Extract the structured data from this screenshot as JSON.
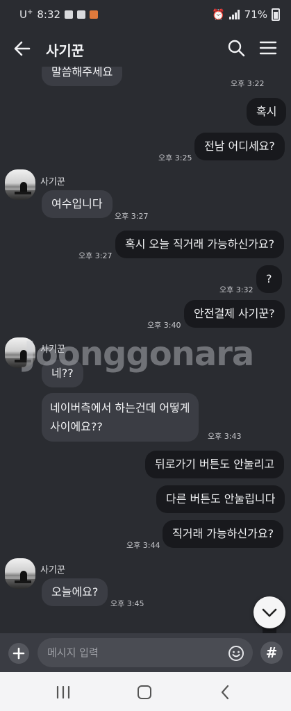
{
  "status_bar": {
    "carrier": "U",
    "carrier_sup": "+",
    "time": "8:32",
    "battery": "71%",
    "battery_level": 0.71
  },
  "header": {
    "title": "사기꾼"
  },
  "messages": [
    {
      "text": "말씀해주세요",
      "time": "오후 3:22"
    },
    {
      "text": "혹시"
    },
    {
      "text": "전남 어디세요?",
      "time": "오후 3:25"
    },
    {
      "sender": "사기꾼"
    },
    {
      "text": "여수입니다",
      "time": "오후 3:27"
    },
    {
      "text": "혹시 오늘 직거래 가능하신가요?",
      "time": "오후 3:27"
    },
    {
      "text": "?",
      "time": "오후 3:32"
    },
    {
      "text": "안전결제 사기꾼?",
      "time": "오후 3:40"
    },
    {
      "sender": "사기꾼"
    },
    {
      "text": "네??"
    },
    {
      "text_line1": "네이버측에서 하는건데 어떻게",
      "text_line2": "사이에요??",
      "time": "오후 3:43"
    },
    {
      "text": "뒤로가기 버튼도 안눌리고"
    },
    {
      "text": "다른 버튼도 안눌립니다"
    },
    {
      "text": "직거래 가능하신가요?",
      "time": "오후 3:44"
    },
    {
      "sender": "사기꾼"
    },
    {
      "text": "오늘에요?",
      "time": "오후 3:45"
    }
  ],
  "watermark": "Joonggonara",
  "composer": {
    "placeholder": "메시지 입력",
    "hash_label": "#"
  },
  "icons": {
    "back": "arrow-left-icon",
    "search": "search-icon",
    "menu": "hamburger-menu-icon",
    "plus": "plus-icon",
    "emoji": "emoji-icon",
    "scroll": "chevron-down-icon"
  },
  "colors": {
    "background": "#2a2c31",
    "incoming_bubble": "#3b3d44",
    "outgoing_bubble": "#18191d"
  }
}
